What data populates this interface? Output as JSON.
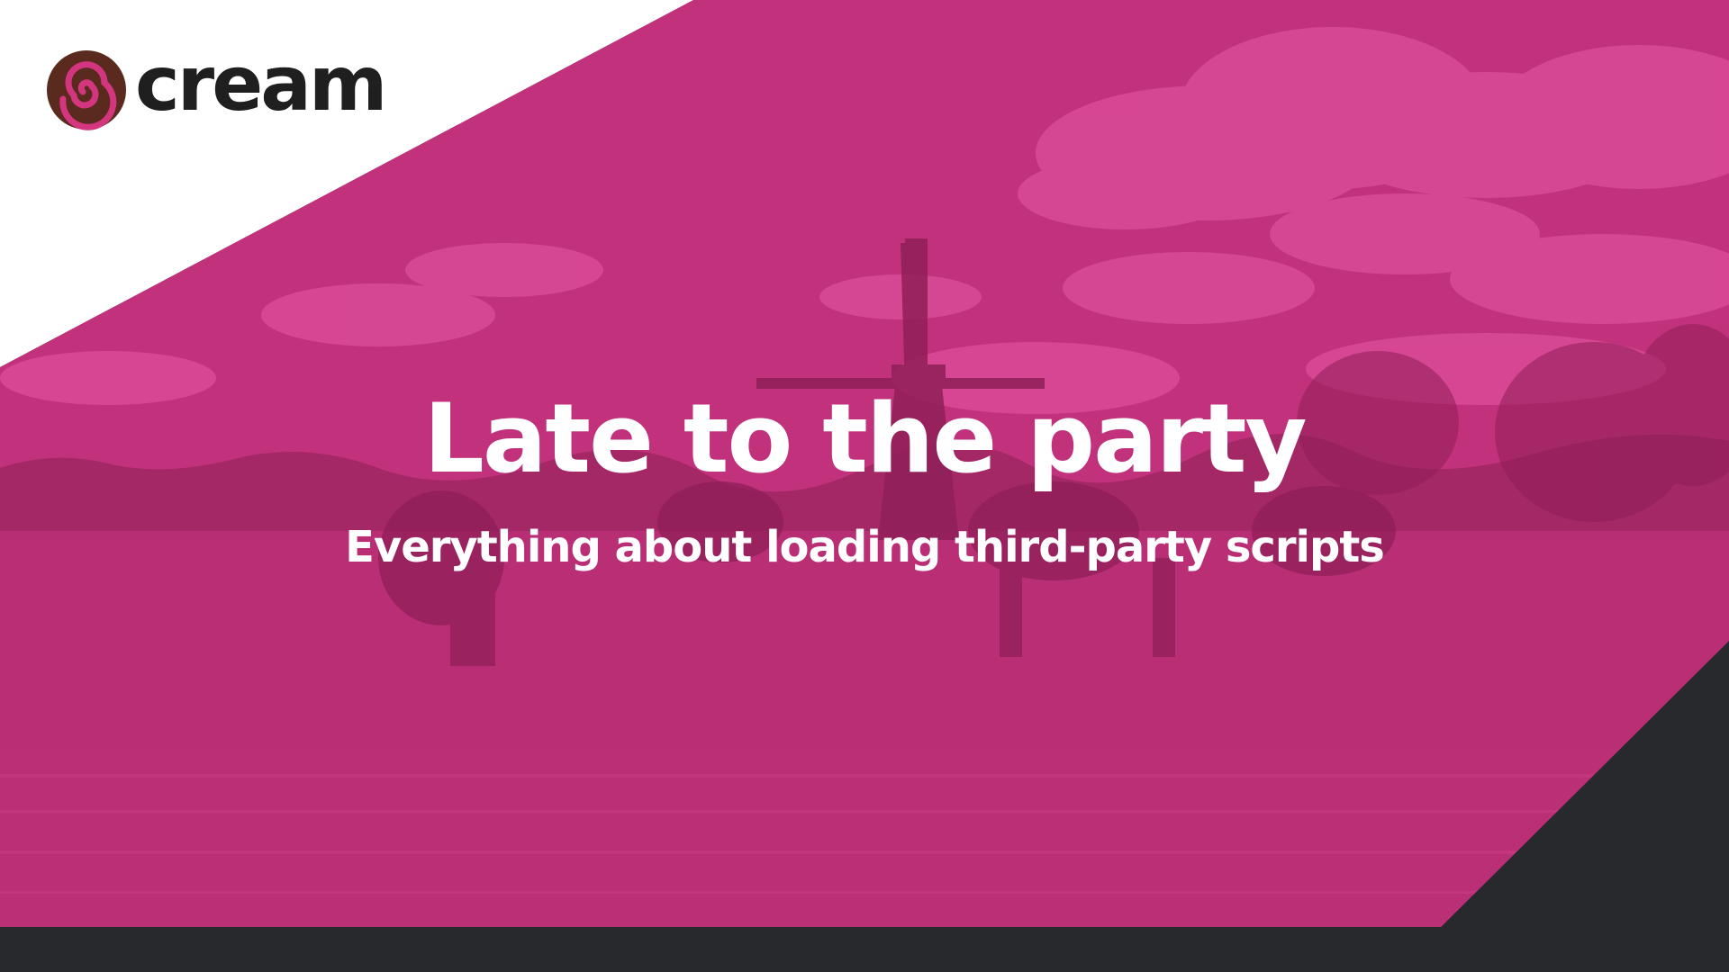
{
  "colors": {
    "magenta": "#c2327c",
    "magenta_light": "#d94a98",
    "magenta_dark": "#8f1f58",
    "dark": "#27292d",
    "white": "#ffffff",
    "logo_brown": "#5a2a1e",
    "logo_swirl": "#d4357f",
    "logo_text": "#1f1f1f"
  },
  "logo": {
    "text": "cream",
    "icon": "swirl-logo-icon"
  },
  "title": "Late to the party",
  "subtitle": "Everything about loading third-party scripts",
  "background": {
    "subject": "windmill and grazing cows by a canal",
    "tint": "magenta"
  }
}
